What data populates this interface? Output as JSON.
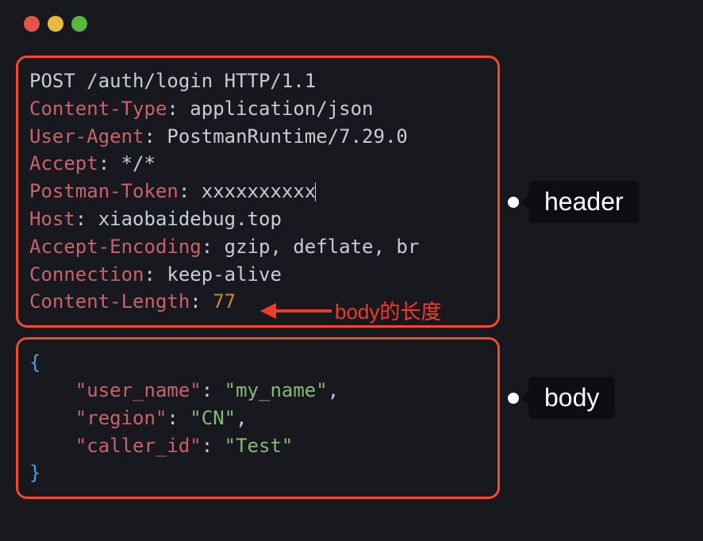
{
  "request_line": "POST /auth/login HTTP/1.1",
  "headers": [
    {
      "name": "Content-Type",
      "value": "application/json"
    },
    {
      "name": "User-Agent",
      "value": "PostmanRuntime/7.29.0"
    },
    {
      "name": "Accept",
      "value": "*/*"
    },
    {
      "name": "Postman-Token",
      "value": "xxxxxxxxxx",
      "cursor": true
    },
    {
      "name": "Host",
      "value": "xiaobaidebug.top"
    },
    {
      "name": "Accept-Encoding",
      "value": "gzip, deflate, br"
    },
    {
      "name": "Connection",
      "value": "keep-alive"
    },
    {
      "name": "Content-Length",
      "value": "77",
      "value_color": "orange"
    }
  ],
  "body": {
    "open": "{",
    "close": "}",
    "fields": [
      {
        "key": "\"user_name\"",
        "value": "\"my_name\"",
        "comma": ","
      },
      {
        "key": "\"region\"",
        "value": "\"CN\"",
        "comma": ","
      },
      {
        "key": "\"caller_id\"",
        "value": "\"Test\"",
        "comma": ""
      }
    ]
  },
  "callouts": {
    "header": "header",
    "body": "body",
    "content_length_note": "body的长度"
  }
}
